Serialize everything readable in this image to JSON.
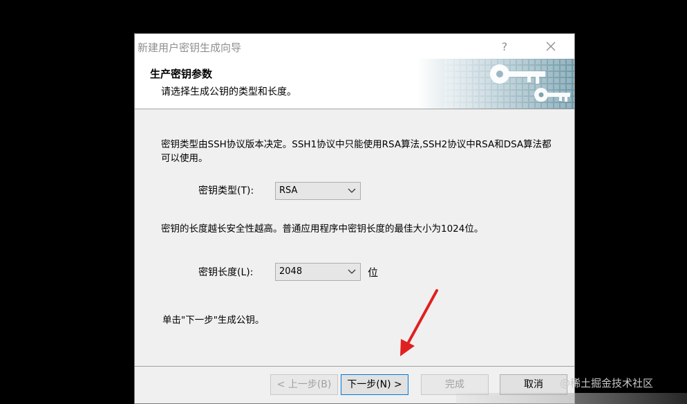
{
  "window": {
    "title": "新建用户密钥生成向导",
    "help_label": "?"
  },
  "header": {
    "title": "生产密钥参数",
    "subtitle": "请选择生成公钥的类型和长度。"
  },
  "body": {
    "paragraph1": "密钥类型由SSH协议版本决定。SSH1协议中只能使用RSA算法,SSH2协议中RSA和DSA算法都可以使用。",
    "key_type_label": "密钥类型(T):",
    "key_type_value": "RSA",
    "paragraph2": "密钥的长度越长安全性越高。普通应用程序中密钥长度的最佳大小为1024位。",
    "key_length_label": "密钥长度(L):",
    "key_length_value": "2048",
    "key_length_unit": "位",
    "instruction": "单击\"下一步\"生成公钥。"
  },
  "buttons": {
    "back": "< 上一步(B)",
    "next": "下一步(N) >",
    "finish": "完成",
    "cancel": "取消"
  },
  "watermark": "@稀土掘金技术社区",
  "colors": {
    "dialog_bg": "#f0f0f0",
    "accent": "#0078d7",
    "arrow": "#e02020"
  }
}
